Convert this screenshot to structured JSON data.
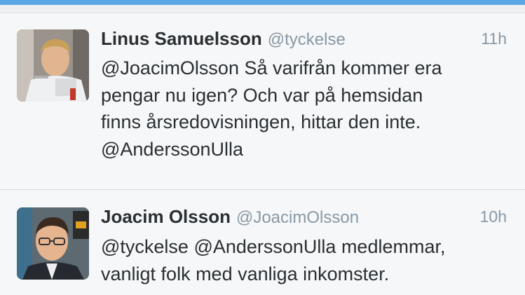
{
  "tweets": [
    {
      "name": "Linus Samuelsson",
      "handle": "@tyckelse",
      "time": "11h",
      "lines": [
        "@JoacimOlsson Så varifrån kommer era",
        "pengar nu igen? Och var på hemsidan",
        "finns årsredovisningen, hittar den inte.",
        "@AnderssonUlla"
      ]
    },
    {
      "name": "Joacim Olsson",
      "handle": "@JoacimOlsson",
      "time": "10h",
      "lines": [
        "@tyckelse @AnderssonUlla medlemmar,",
        "vanligt folk med vanliga inkomster."
      ]
    }
  ],
  "colors": {
    "accent_bar": "#5aa9e6",
    "name_text": "#292f33",
    "meta_text": "#8899a6",
    "background": "#f6f7f8"
  }
}
